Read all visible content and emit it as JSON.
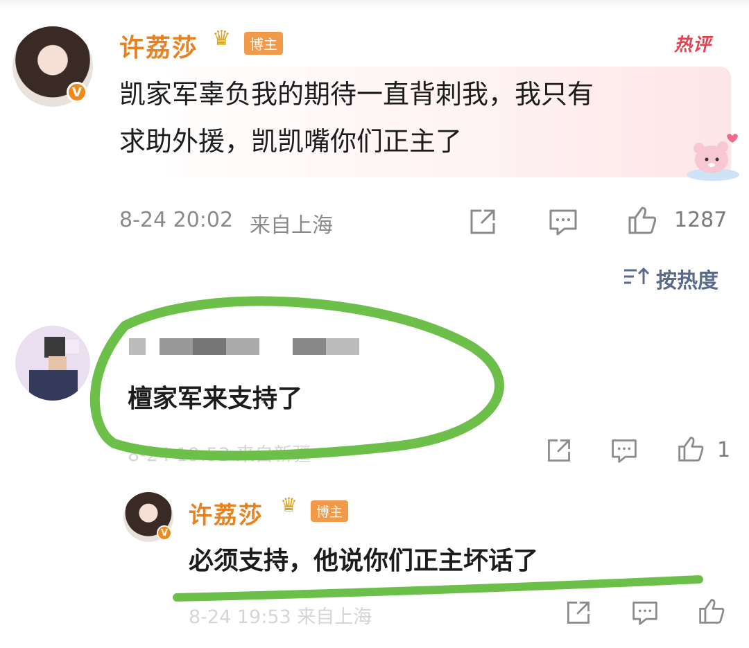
{
  "top_comment": {
    "username": "许荔莎",
    "author_tag": "博主",
    "hot_label": "热评",
    "verified_mark": "V",
    "text_line1": "凯家军辜负我的期待一直背刺我，我只有",
    "text_line2": "求助外援，凯凯嘴你们正主了",
    "timestamp": "8-24 20:02",
    "location": "来自上海",
    "like_count": "1287"
  },
  "sort": {
    "label": "按热度",
    "icon": "sort-icon"
  },
  "second_comment": {
    "text": "檀家军来支持了",
    "meta_faded": "8-24 19:53 来自新疆",
    "like_count": "1"
  },
  "reply": {
    "username": "许荔莎",
    "author_tag": "博主",
    "verified_mark": "V",
    "text": "必须支持，他说你们正主坏话了",
    "meta_faded": "8-24 19:53 来自上海"
  },
  "colors": {
    "username": "#e8811f",
    "hot": "#e5404e",
    "annotation_green": "#6cc04a",
    "meta_gray": "#8a8a8a"
  },
  "icons": [
    "share-icon",
    "comment-icon",
    "like-icon",
    "crown-icon",
    "verified-icon",
    "sort-icon",
    "sticker-bear-icon"
  ]
}
